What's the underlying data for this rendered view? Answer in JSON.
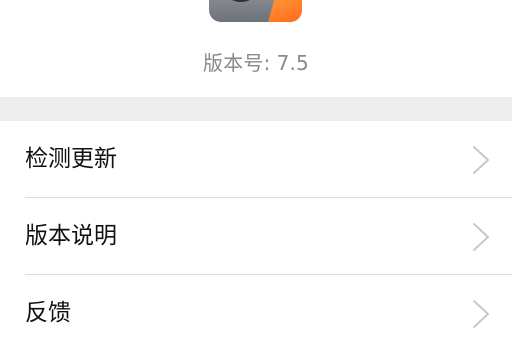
{
  "about": {
    "version_label": "版本号:",
    "version_value": "7.5"
  },
  "menu": {
    "items": [
      {
        "label": "检测更新",
        "icon": "chevron-right-icon"
      },
      {
        "label": "版本说明",
        "icon": "chevron-right-icon"
      },
      {
        "label": "反馈",
        "icon": "chevron-right-icon"
      }
    ]
  },
  "colors": {
    "background": "#ffffff",
    "separator_band": "#eeeeef",
    "divider": "#dcdcdc",
    "version_text": "#8a8a8a",
    "row_text": "#111111",
    "chevron": "#c8c8cc",
    "icon_orange": "#ff6a1a"
  }
}
